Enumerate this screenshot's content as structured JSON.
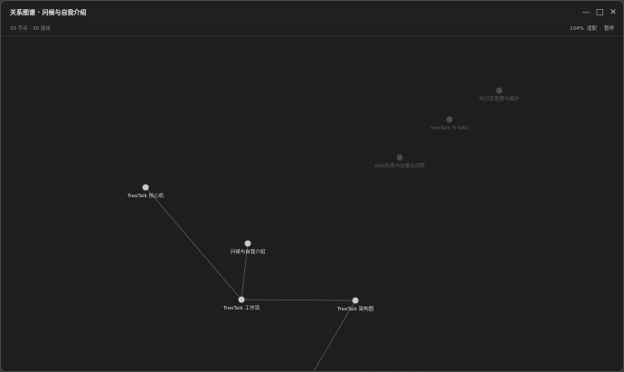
{
  "window": {
    "title": "关系图谱 · 问候与自我介绍",
    "min_glyph": "—",
    "max_glyph": "□",
    "close_glyph": "✕"
  },
  "toolbar": {
    "stats": "39 节点 · 38 连线",
    "zoom": "104%",
    "fit_label": "适配",
    "pause_label": "暂停"
  },
  "graph": {
    "nodes": [
      {
        "id": "core",
        "label": "TreeTalk 核心机",
        "state": "active"
      },
      {
        "id": "greet",
        "label": "问候与自我介绍",
        "state": "active"
      },
      {
        "id": "workflow",
        "label": "TreeTalk 工作流",
        "state": "active"
      },
      {
        "id": "arch",
        "label": "TreeTalk 架构图",
        "state": "active"
      },
      {
        "id": "rag",
        "label": "RAG检索与向量化流程",
        "state": "faded"
      },
      {
        "id": "treetalk_rag",
        "label": "TreeTalk 与 RAG",
        "state": "faded"
      },
      {
        "id": "know",
        "label": "知识库管理与维护",
        "state": "faded"
      }
    ],
    "edges": [
      [
        "core",
        "workflow"
      ],
      [
        "greet",
        "workflow"
      ],
      [
        "workflow",
        "arch"
      ]
    ]
  },
  "colors": {
    "canvas_bg": "#1e1e1e",
    "node_active": "#c8c8c8",
    "node_faded": "#4a4a4a",
    "edge": "#5a5a5a"
  }
}
